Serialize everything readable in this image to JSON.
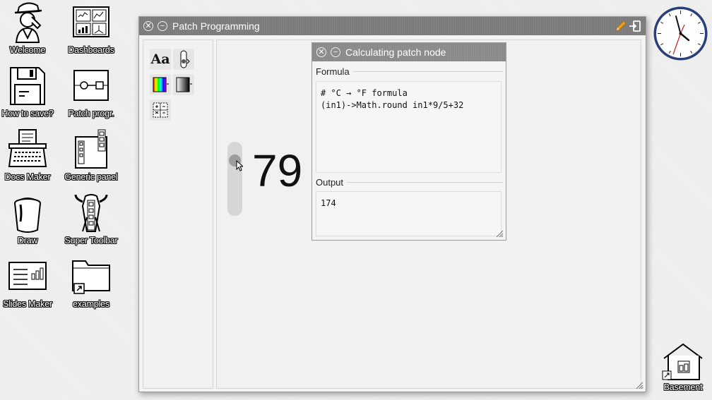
{
  "desktop": {
    "icons": [
      {
        "label": "Welcome",
        "icon": "detective-icon"
      },
      {
        "label": "Dashboards",
        "icon": "dashboards-icon"
      },
      {
        "label": "How to save?",
        "icon": "floppy-disk-icon"
      },
      {
        "label": "Patch progr.",
        "icon": "patch-icon"
      },
      {
        "label": "Docs Maker",
        "icon": "typewriter-icon"
      },
      {
        "label": "Generic panel",
        "icon": "generic-panel-icon"
      },
      {
        "label": "Draw",
        "icon": "paint-bucket-icon"
      },
      {
        "label": "Super Toolbar",
        "icon": "super-toolbar-icon"
      },
      {
        "label": "Slides Maker",
        "icon": "slides-icon"
      },
      {
        "label": "examples",
        "icon": "folder-shortcut-icon"
      }
    ],
    "basement_label": "Basement"
  },
  "window": {
    "title": "Patch Programming",
    "close_glyph": "✕",
    "minimize_glyph": "−",
    "edit_icon": "pencil-icon",
    "exit_icon": "exit-icon"
  },
  "main": {
    "value_display": "79",
    "slider_value": 79
  },
  "node_window": {
    "title": "Calculating patch node",
    "formula_label": "Formula",
    "formula_lines": [
      "# °C → °F formula",
      "(in1)->Math.round in1*9/5+32"
    ],
    "output_label": "Output",
    "output_value": "174"
  },
  "colors": {
    "titlebar": "#7b7b7b",
    "pencil": "#f0a020",
    "clock_rim": "#2a3f7a",
    "clock_second_hand": "#d02020"
  }
}
